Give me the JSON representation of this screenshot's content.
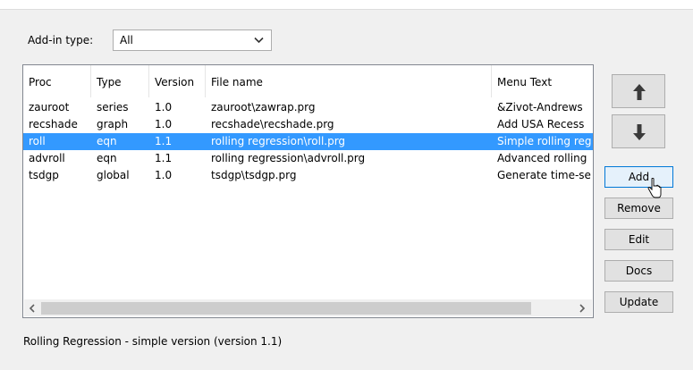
{
  "addin_type": {
    "label": "Add-in type:",
    "value": "All"
  },
  "columns": [
    {
      "label": "Proc"
    },
    {
      "label": "Type"
    },
    {
      "label": "Version"
    },
    {
      "label": "File name"
    },
    {
      "label": "Menu Text"
    }
  ],
  "rows": [
    {
      "proc": "zauroot",
      "type": "series",
      "version": "1.0",
      "file": "zauroot\\zawrap.prg",
      "menu": "&Zivot-Andrews"
    },
    {
      "proc": "recshade",
      "type": "graph",
      "version": "1.0",
      "file": "recshade\\recshade.prg",
      "menu": "Add USA Recess"
    },
    {
      "proc": "roll",
      "type": "eqn",
      "version": "1.1",
      "file": "rolling regression\\roll.prg",
      "menu": "Simple rolling reg"
    },
    {
      "proc": "advroll",
      "type": "eqn",
      "version": "1.1",
      "file": "rolling regression\\advroll.prg",
      "menu": "Advanced rolling"
    },
    {
      "proc": "tsdgp",
      "type": "global",
      "version": "1.0",
      "file": "tsdgp\\tsdgp.prg",
      "menu": "Generate time-se"
    }
  ],
  "selected_row": "roll",
  "buttons": {
    "move_up_icon": "arrow-up-icon",
    "move_down_icon": "arrow-down-icon",
    "add": "Add",
    "remove": "Remove",
    "edit": "Edit",
    "docs": "Docs",
    "update": "Update"
  },
  "status": "Rolling Regression - simple version (version 1.1)",
  "colors": {
    "selection": "#3399ff",
    "focus_border": "#0078d7"
  }
}
